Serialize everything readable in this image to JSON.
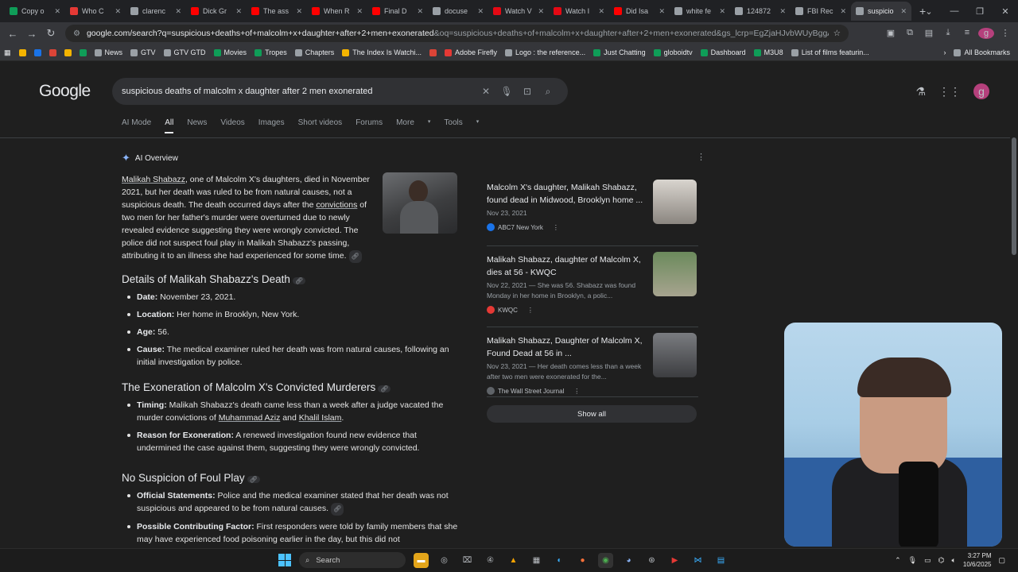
{
  "browser": {
    "tabs": [
      {
        "label": "Copy o",
        "color": "#0f9d58"
      },
      {
        "label": "Who C",
        "color": "#e53935"
      },
      {
        "label": "clarenc",
        "color": "#9aa0a6"
      },
      {
        "label": "Dick Gr",
        "color": "#ff0000"
      },
      {
        "label": "The ass",
        "color": "#ff0000"
      },
      {
        "label": "When R",
        "color": "#ff0000"
      },
      {
        "label": "Final D",
        "color": "#ff0000"
      },
      {
        "label": "docuse",
        "color": "#9aa0a6"
      },
      {
        "label": "Watch V",
        "color": "#e50914"
      },
      {
        "label": "Watch I",
        "color": "#e50914"
      },
      {
        "label": "Did Isa",
        "color": "#ff0000"
      },
      {
        "label": "white fe",
        "color": "#9aa0a6"
      },
      {
        "label": "124872",
        "color": "#9aa0a6"
      },
      {
        "label": "FBI Rec",
        "color": "#9aa0a6"
      },
      {
        "label": "suspicio",
        "color": "#9aa0a6",
        "active": true
      }
    ],
    "url_main": "google.com/search?q=suspicious+deaths+of+malcolm+x+daughter+after+2+men+exonerated",
    "url_rest": "&oq=suspicious+deaths+of+malcolm+x+daughter+after+2+men+exonerated&gs_lcrp=EgZjaHJvbWUyBggAEEUYOdIBCTlwNjgyaj...",
    "profile_initial": "g",
    "bookmarks": [
      {
        "label": "",
        "color": "#f4b400"
      },
      {
        "label": "",
        "color": "#1a73e8"
      },
      {
        "label": "",
        "color": "#db4437"
      },
      {
        "label": "",
        "color": "#f4b400"
      },
      {
        "label": "",
        "color": "#0f9d58"
      },
      {
        "label": "News",
        "color": "#9aa0a6"
      },
      {
        "label": "GTV",
        "color": "#9aa0a6"
      },
      {
        "label": "GTV GTD",
        "color": "#9aa0a6"
      },
      {
        "label": "Movies",
        "color": "#0f9d58"
      },
      {
        "label": "Tropes",
        "color": "#0f9d58"
      },
      {
        "label": "Chapters",
        "color": "#9aa0a6"
      },
      {
        "label": "The Index Is Watchi...",
        "color": "#f4b400"
      },
      {
        "label": "",
        "color": "#db4437"
      },
      {
        "label": "Adobe Firefly",
        "color": "#e53935"
      },
      {
        "label": "Logo : the reference...",
        "color": "#9aa0a6"
      },
      {
        "label": "Just Chatting",
        "color": "#0f9d58"
      },
      {
        "label": "globoidtv",
        "color": "#0f9d58"
      },
      {
        "label": "Dashboard",
        "color": "#0f9d58"
      },
      {
        "label": "M3U8",
        "color": "#0f9d58"
      },
      {
        "label": "List of films featurin...",
        "color": "#9aa0a6"
      }
    ],
    "all_bookmarks": "All Bookmarks"
  },
  "google": {
    "logo": "Google",
    "query": "suspicious deaths of malcolm x daughter after 2 men exonerated",
    "avatar": "g",
    "tabs": [
      "AI Mode",
      "All",
      "News",
      "Videos",
      "Images",
      "Short videos",
      "Forums",
      "More",
      "Tools"
    ],
    "active_tab": "All"
  },
  "overview": {
    "label": "AI Overview",
    "summary": {
      "link": "Malikah Shabazz",
      "part1": ", one of Malcolm X's daughters, died in November 2021, but her death was ruled to be from natural causes, not a suspicious death. The death occurred days after the ",
      "link2": "convictions",
      "part2": " of two men for her father's murder were overturned due to newly revealed evidence suggesting they were wrongly convicted. The police did not suspect foul play in Malikah Shabazz's passing, attributing it to an illness she had experienced for some time."
    },
    "sections": [
      {
        "title": "Details of Malikah Shabazz's Death",
        "items": [
          {
            "label": "Date:",
            "text": " November 23, 2021."
          },
          {
            "label": "Location:",
            "text": " Her home in Brooklyn, New York."
          },
          {
            "label": "Age:",
            "text": " 56."
          },
          {
            "label": "Cause:",
            "text": " The medical examiner ruled her death was from natural causes, following an initial investigation by police."
          }
        ]
      },
      {
        "title": "The Exoneration of Malcolm X's Convicted Murderers",
        "items": [
          {
            "label": "Timing:",
            "text": " Malikah Shabazz's death came less than a week after a judge vacated the murder convictions of ",
            "l1": "Muhammad Aziz",
            "mid": " and ",
            "l2": "Khalil Islam",
            "end": "."
          },
          {
            "label": "Reason for Exoneration:",
            "text": " A renewed investigation found new evidence that undermined the case against them, suggesting they were wrongly convicted."
          }
        ]
      },
      {
        "title": "No Suspicion of Foul Play",
        "items": [
          {
            "label": "Official Statements:",
            "text": " Police and the medical examiner stated that her death was not suspicious and appeared to be from natural causes."
          },
          {
            "label": "Possible Contributing Factor:",
            "text": " First responders were told by family members that she may have experienced food poisoning earlier in the day, but this did not"
          }
        ]
      }
    ],
    "sources": [
      {
        "title": "Malcolm X's daughter, Malikah Shabazz, found dead in Midwood, Brooklyn home ...",
        "meta": "Nov 23, 2021",
        "source": "ABC7 New York",
        "color": "#1a73e8"
      },
      {
        "title": "Malikah Shabazz, daughter of Malcolm X, dies at 56 - KWQC",
        "meta": "Nov 22, 2021 — She was 56. Shabazz was found Monday in her home in Brooklyn, a polic...",
        "source": "KWQC",
        "color": "#e53935"
      },
      {
        "title": "Malikah Shabazz, Daughter of Malcolm X, Found Dead at 56 in ...",
        "meta": "Nov 23, 2021 — Her death comes less than a week after two men were exonerated for the...",
        "source": "The Wall Street Journal",
        "color": "#5f6368"
      }
    ],
    "show_all": "Show all"
  },
  "taskbar": {
    "search": "Search",
    "time": "3:27 PM",
    "date": "10/6/2025"
  }
}
